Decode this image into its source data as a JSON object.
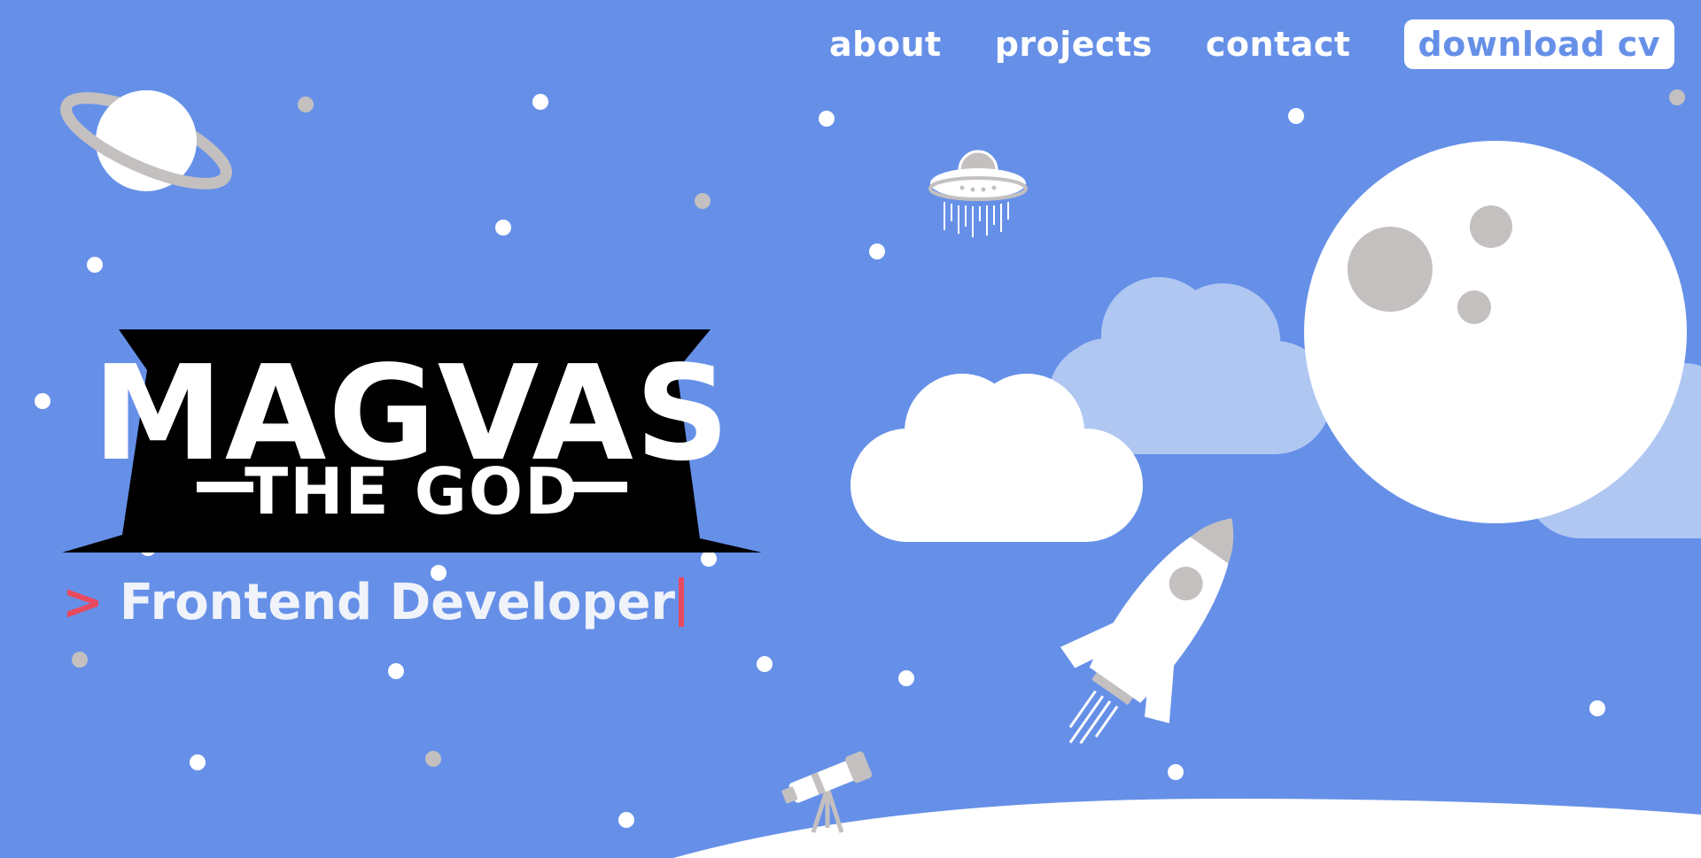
{
  "nav": {
    "links": [
      {
        "label": "about"
      },
      {
        "label": "projects"
      },
      {
        "label": "contact"
      }
    ],
    "cv_label": "download cv"
  },
  "logo": {
    "line1": "MAGVAS",
    "line2": "THE GOD"
  },
  "hero": {
    "prompt": ">",
    "role": "Frontend Developer"
  },
  "colors": {
    "background": "#6690e8",
    "prompt_accent": "#e84a5f",
    "white": "#ffffff",
    "light_cloud": "#b0c7f2",
    "grey": "#c4c0bf"
  },
  "icons": [
    "planet-icon",
    "ufo-icon",
    "moon-icon",
    "cloud-icon",
    "rocket-icon",
    "telescope-icon",
    "star-dot"
  ]
}
